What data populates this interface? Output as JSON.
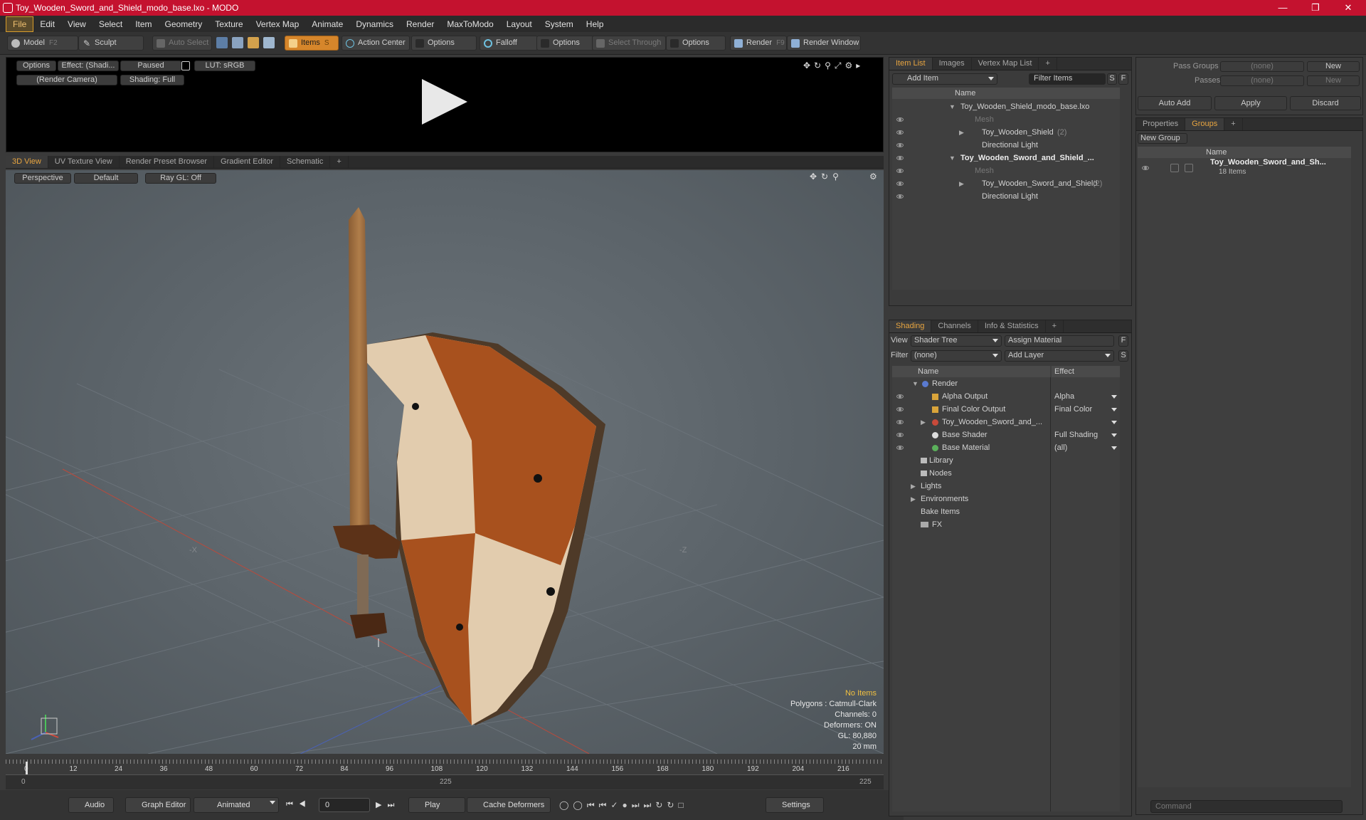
{
  "window": {
    "title": "Toy_Wooden_Sword_and_Shield_modo_base.lxo - MODO"
  },
  "menu": [
    "File",
    "Edit",
    "View",
    "Select",
    "Item",
    "Geometry",
    "Texture",
    "Vertex Map",
    "Animate",
    "Dynamics",
    "Render",
    "MaxToModo",
    "Layout",
    "System",
    "Help"
  ],
  "toolbar": {
    "model": "Model",
    "model_key": "F2",
    "sculpt": "Sculpt",
    "auto_select": "Auto Select",
    "items": "Items",
    "items_key": "S",
    "action_center": "Action Center",
    "options1": "Options",
    "falloff": "Falloff",
    "options2": "Options",
    "select_through": "Select Through",
    "options3": "Options",
    "render": "Render",
    "render_key": "F9",
    "render_window": "Render Window"
  },
  "preview": {
    "options": "Options",
    "effect": "Effect: (Shadi...",
    "paused": "Paused",
    "lut": "LUT: sRGB",
    "camera": "(Render Camera)",
    "shading": "Shading: Full"
  },
  "view_tabs": [
    "3D View",
    "UV Texture View",
    "Render Preset Browser",
    "Gradient Editor",
    "Schematic",
    "+"
  ],
  "viewport": {
    "perspective": "Perspective",
    "default": "Default",
    "raygl": "Ray GL: Off",
    "axis_x_label": "-X",
    "axis_z_label": "-Z",
    "stats": [
      "No Items",
      "Polygons : Catmull-Clark",
      "Channels: 0",
      "Deformers: ON",
      "GL: 80,880",
      "20 mm"
    ]
  },
  "timeline": {
    "ticks": [
      "0",
      "12",
      "24",
      "36",
      "48",
      "60",
      "72",
      "84",
      "96",
      "108",
      "120",
      "132",
      "144",
      "156",
      "168",
      "180",
      "192",
      "204",
      "216"
    ],
    "start": "0",
    "mid": "225",
    "end": "225"
  },
  "bottom": {
    "audio": "Audio",
    "graph_editor": "Graph Editor",
    "animated": "Animated",
    "frame": "0",
    "play": "Play",
    "cache": "Cache Deformers",
    "settings": "Settings"
  },
  "item_list": {
    "tabs": [
      "Item List",
      "Images",
      "Vertex Map List",
      "+"
    ],
    "add_item": "Add Item",
    "filter": "Filter Items",
    "btn_s": "S",
    "btn_f": "F",
    "col_name": "Name",
    "rows": [
      {
        "label": "Toy_Wooden_Shield_modo_base.lxo",
        "count": ""
      },
      {
        "label": "Mesh",
        "count": ""
      },
      {
        "label": "Toy_Wooden_Shield",
        "count": "(2)"
      },
      {
        "label": "Directional Light",
        "count": ""
      },
      {
        "label": "Toy_Wooden_Sword_and_Shield_...",
        "count": ""
      },
      {
        "label": "Mesh",
        "count": ""
      },
      {
        "label": "Toy_Wooden_Sword_and_Shield",
        "count": "(2)"
      },
      {
        "label": "Directional Light",
        "count": ""
      }
    ]
  },
  "shading": {
    "tabs": [
      "Shading",
      "Channels",
      "Info & Statistics",
      "+"
    ],
    "view_label": "View",
    "view_value": "Shader Tree",
    "assign": "Assign Material",
    "filter_label": "Filter",
    "filter_value": "(none)",
    "add_layer": "Add Layer",
    "btn_f": "F",
    "btn_s": "S",
    "col_name": "Name",
    "col_effect": "Effect",
    "rows": [
      {
        "label": "Render",
        "effect": ""
      },
      {
        "label": "Alpha Output",
        "effect": "Alpha"
      },
      {
        "label": "Final Color Output",
        "effect": "Final Color"
      },
      {
        "label": "Toy_Wooden_Sword_and_...",
        "effect": ""
      },
      {
        "label": "Base Shader",
        "effect": "Full Shading"
      },
      {
        "label": "Base Material",
        "effect": "(all)"
      },
      {
        "label": "Library",
        "effect": ""
      },
      {
        "label": "Nodes",
        "effect": ""
      },
      {
        "label": "Lights",
        "effect": ""
      },
      {
        "label": "Environments",
        "effect": ""
      },
      {
        "label": "Bake Items",
        "effect": ""
      },
      {
        "label": "FX",
        "effect": ""
      }
    ]
  },
  "passes": {
    "pass_groups": "Pass Groups",
    "passes": "Passes",
    "none1": "(none)",
    "none2": "(none)",
    "new1": "New",
    "new2": "New",
    "auto_add": "Auto Add",
    "apply": "Apply",
    "discard": "Discard"
  },
  "groups": {
    "tabs": [
      "Properties",
      "Groups",
      "+"
    ],
    "new_group": "New Group",
    "col_name": "Name",
    "item_name": "Toy_Wooden_Sword_and_Sh...",
    "item_count": "18 Items"
  },
  "command": {
    "placeholder": "Command"
  },
  "colors": {
    "accent": "#e8a540",
    "titlebar": "#c4122f",
    "items_button": "#d6862b"
  }
}
